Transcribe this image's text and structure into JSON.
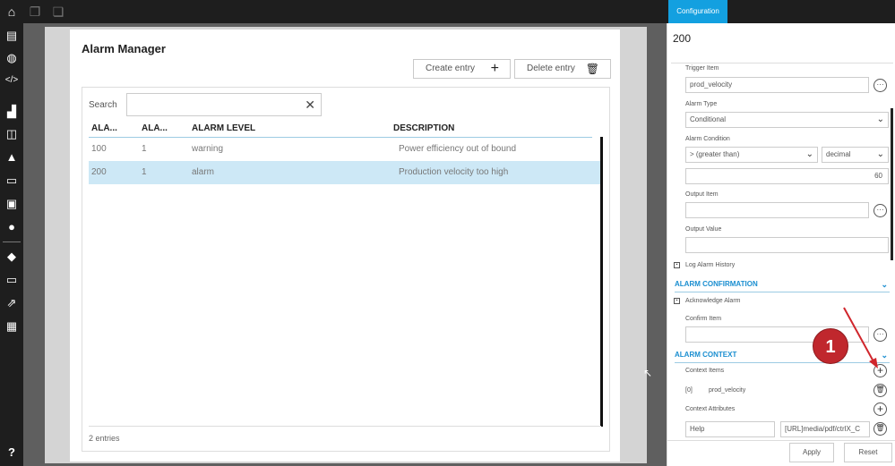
{
  "topbar": {
    "icons": [
      "home-icon",
      "copy-icon",
      "paste-icon"
    ]
  },
  "sidebar": {
    "icons": [
      "dashboard-icon",
      "globe-icon",
      "code-icon",
      "factory-icon",
      "chart-icon",
      "alarm-icon",
      "device-icon",
      "report-icon",
      "user-icon",
      "package-icon",
      "display-settings-icon",
      "export-icon",
      "grid-icon",
      "help-icon"
    ]
  },
  "panel": {
    "title": "Alarm Manager",
    "create_label": "Create entry",
    "delete_label": "Delete entry",
    "search_label": "Search",
    "search_value": "",
    "columns": [
      "ALA...",
      "ALA...",
      "ALARM LEVEL",
      "DESCRIPTION"
    ],
    "rows": [
      {
        "c1": "100",
        "c2": "1",
        "level": "warning",
        "desc": "Power efficiency out of bound"
      },
      {
        "c1": "200",
        "c2": "1",
        "level": "alarm",
        "desc": "Production velocity too high"
      }
    ],
    "entries": "2 entries"
  },
  "config": {
    "tab": "Configuration",
    "title": "200",
    "trigger_item_label": "Trigger Item",
    "trigger_item": "prod_velocity",
    "alarm_type_label": "Alarm Type",
    "alarm_type": "Conditional",
    "alarm_condition_label": "Alarm Condition",
    "condition_op": "> (greater than)",
    "condition_type": "decimal",
    "condition_value": "60",
    "output_item_label": "Output Item",
    "output_item": "",
    "output_value_label": "Output Value",
    "output_value": "",
    "log_history_label": "Log Alarm History",
    "confirmation_header": "ALARM CONFIRMATION",
    "acknowledge_label": "Acknowledge Alarm",
    "confirm_item_label": "Confirm Item",
    "confirm_item": "",
    "context_header": "ALARM CONTEXT",
    "context_items_label": "Context Items",
    "context_item_index": "[0]",
    "context_item_value": "prod_velocity",
    "context_attributes_label": "Context Attributes",
    "attr_key": "Help",
    "attr_value": "[URL]media/pdf/ctrlX_C",
    "more": "···",
    "apply_label": "Apply",
    "reset_label": "Reset"
  },
  "annotation": {
    "badge_number": "1",
    "colors": {
      "badge": "#c0272d",
      "accent": "#13a0e0"
    }
  }
}
